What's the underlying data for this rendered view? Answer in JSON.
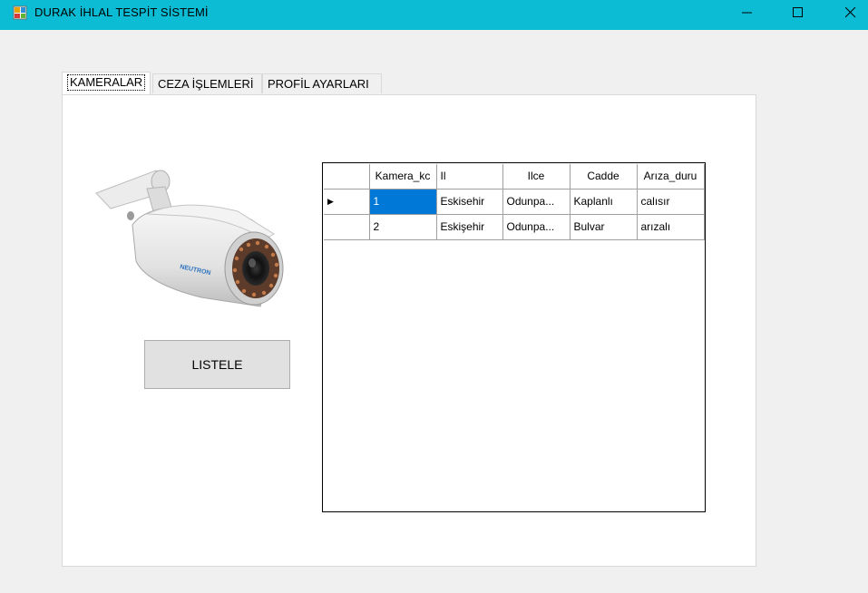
{
  "window": {
    "title": "DURAK İHLAL TESPİT SİSTEMİ",
    "icon": "app-window-icon",
    "controls": [
      "minimize-icon",
      "maximize-icon",
      "close-icon"
    ]
  },
  "tabs": [
    {
      "label": "KAMERALAR",
      "active": true
    },
    {
      "label": "CEZA İŞLEMLERİ",
      "active": false
    },
    {
      "label": "PROFİL AYARLARI",
      "active": false
    }
  ],
  "camera_panel": {
    "image": "security-camera-image",
    "brand_text": "NEUTRON",
    "list_button": "LISTELE"
  },
  "grid": {
    "columns": [
      "Kamera_kc",
      "Il",
      "Ilce",
      "Cadde",
      "Arıza_duru"
    ],
    "rows": [
      {
        "marker": "▶",
        "cells": [
          "1",
          "Eskisehir",
          "Odunpa...",
          "Kaplanlı",
          "calısır"
        ]
      },
      {
        "marker": "",
        "cells": [
          "2",
          "Eskişehir",
          "Odunpa...",
          "Bulvar",
          "arızalı"
        ]
      }
    ],
    "selected_color": "#0078d7"
  },
  "colors": {
    "titlebar": "#0cbcd4",
    "background": "#f0f0f0"
  }
}
